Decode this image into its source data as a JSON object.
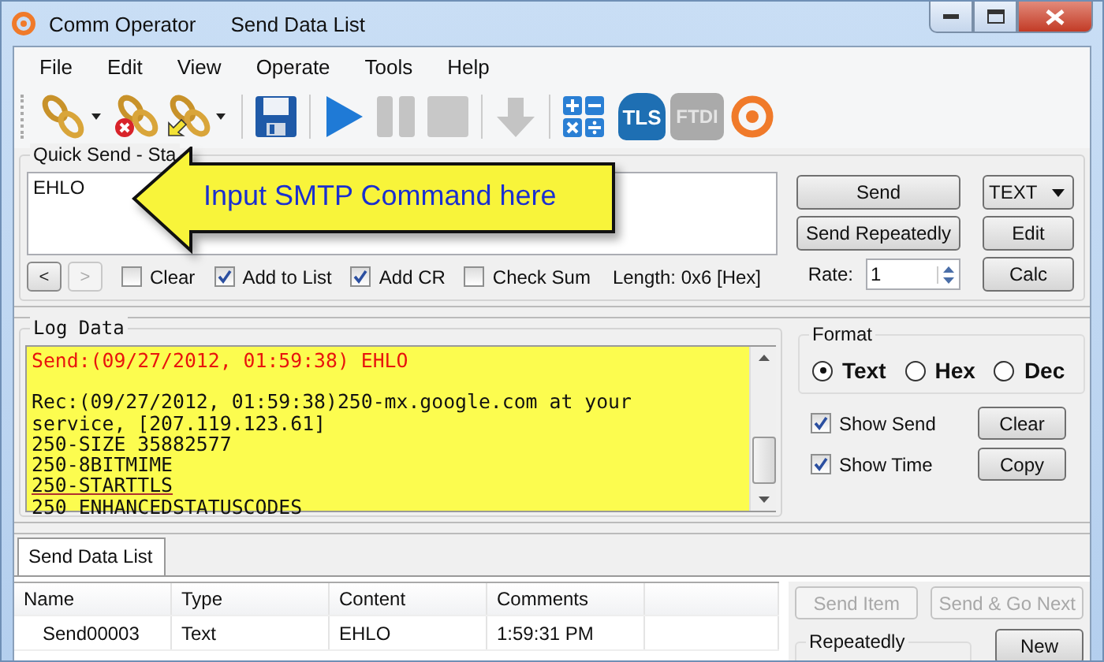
{
  "window": {
    "title": "Comm Operator",
    "document": "Send Data List"
  },
  "menu": [
    "File",
    "Edit",
    "View",
    "Operate",
    "Tools",
    "Help"
  ],
  "toolbar": {
    "tls_label": "TLS",
    "ftdi_label": "FTDI",
    "ftdi_disabled": true
  },
  "quick_send": {
    "title": "Quick Send - Sta",
    "value": "EHLO",
    "callout": "Input SMTP Command here",
    "nav": [
      {
        "label": "<",
        "disabled": false
      },
      {
        "label": ">",
        "disabled": true
      }
    ],
    "options": [
      {
        "label": "Clear",
        "checked": false
      },
      {
        "label": "Add to List",
        "checked": true
      },
      {
        "label": "Add CR",
        "checked": true
      },
      {
        "label": "Check Sum",
        "checked": false
      }
    ],
    "length": "Length: 0x6 [Hex]",
    "send": "Send",
    "send_repeatedly": "Send Repeatedly",
    "mode": "TEXT",
    "edit": "Edit",
    "calc": "Calc",
    "rate_label": "Rate:",
    "rate": "1"
  },
  "log": {
    "title": "Log Data",
    "lines": [
      {
        "kind": "send",
        "text": "Send:(09/27/2012, 01:59:38) EHLO"
      },
      {
        "kind": "rec",
        "text": "Rec:(09/27/2012, 01:59:38)250-mx.google.com at your"
      },
      {
        "kind": "rec",
        "text": "service, [207.119.123.61]"
      },
      {
        "kind": "rec",
        "text": "250-SIZE 35882577"
      },
      {
        "kind": "rec",
        "text": "250-8BITMIME"
      },
      {
        "kind": "rec",
        "text": "250-STARTTLS",
        "underlined": true
      },
      {
        "kind": "rec",
        "text": "250 ENHANCEDSTATUSCODES"
      }
    ]
  },
  "format": {
    "title": "Format",
    "options": [
      {
        "label": "Text",
        "selected": true
      },
      {
        "label": "Hex",
        "selected": false
      },
      {
        "label": "Dec",
        "selected": false
      }
    ],
    "show": [
      {
        "label": "Show Send",
        "checked": true
      },
      {
        "label": "Show Time",
        "checked": true
      }
    ],
    "clear": "Clear",
    "copy": "Copy"
  },
  "tabs": [
    {
      "label": "Send Data List",
      "selected": true
    }
  ],
  "table": {
    "columns": [
      "Name",
      "Type",
      "Content",
      "Comments"
    ],
    "rows": [
      [
        "Send00003",
        "Text",
        "EHLO",
        "1:59:31 PM"
      ]
    ]
  },
  "actions": [
    {
      "label": "Send Item",
      "disabled": true
    },
    {
      "label": "Send & Go Next",
      "disabled": true
    }
  ],
  "repeatedly": "Repeatedly",
  "new": "New"
}
